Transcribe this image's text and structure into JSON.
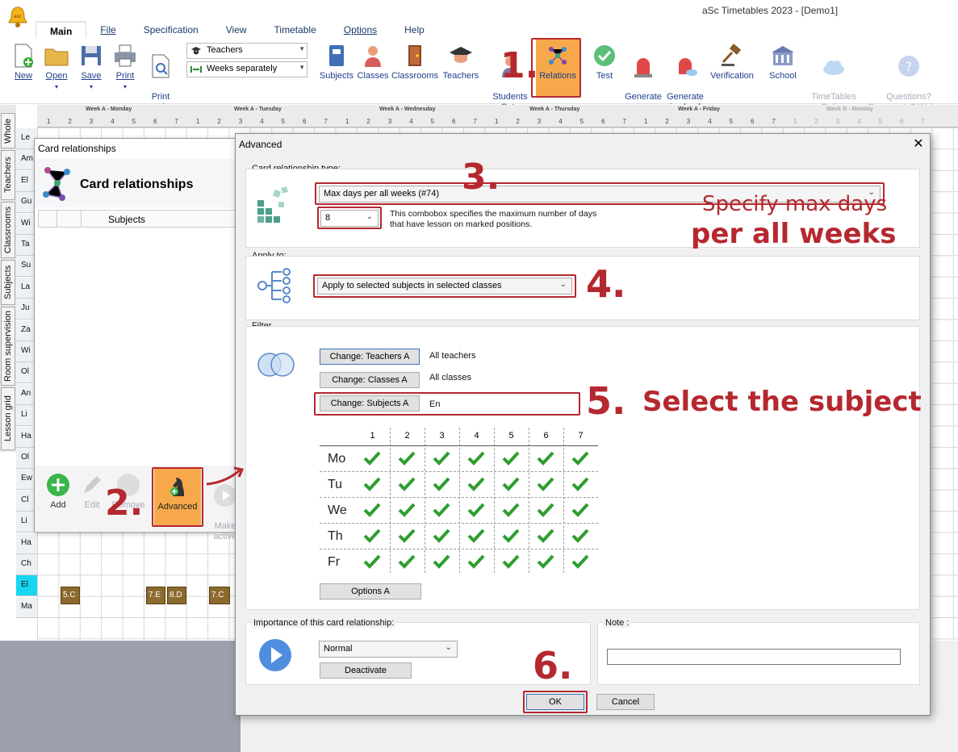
{
  "app": {
    "title": "aSc Timetables 2023  - [Demo1]"
  },
  "menu": [
    "Main",
    "File",
    "Specification",
    "View",
    "Timetable",
    "Options",
    "Help"
  ],
  "ribbon": {
    "new": "New",
    "open": "Open",
    "save": "Save",
    "print": "Print",
    "print_preview": "Print\npreview",
    "combo_teachers": "Teachers",
    "combo_weeks": "Weeks separately",
    "subjects": "Subjects",
    "classes": "Classes",
    "classrooms": "Classrooms",
    "teachers": "Teachers",
    "students": "Students\nSets",
    "relations": "Relations",
    "test": "Test",
    "generate_new": "Generate\nnew",
    "generate_cloud": "Generate\nin cloud",
    "verification": "Verification",
    "school": "School",
    "tt_online": "TimeTables\nOnline",
    "questions": "Questions?\nComments? Write us"
  },
  "side_tabs": [
    "Whole",
    "Teachers",
    "Classrooms",
    "Subjects",
    "Room supervision",
    "Lesson grid"
  ],
  "grid": {
    "weeks": [
      "Week A - Monday",
      "Week A - Tuesday",
      "Week A - Wednesday",
      "Week A - Thursday",
      "Week A - Friday",
      "Week B - Monday"
    ],
    "periods": [
      "1",
      "2",
      "3",
      "4",
      "5",
      "6",
      "7"
    ],
    "rows": [
      "Le",
      "Am",
      "El",
      "Gu",
      "Wi",
      "Ta",
      "Su",
      "La",
      "Ju",
      "Za",
      "Wi",
      "Ol",
      "An",
      "Li",
      "Ha",
      "Ol",
      "Ew",
      "Cl",
      "Li",
      "Ha",
      "Ch",
      "El",
      "Ma"
    ],
    "cards": [
      "5.C",
      "7.E",
      "8.D",
      "7.C"
    ]
  },
  "card_rel": {
    "window_title": "Card relationships",
    "heading": "Card relationships",
    "col_subjects": "Subjects",
    "add": "Add",
    "edit": "Edit",
    "remove": "Remove",
    "advanced": "Advanced",
    "make_active": "Make\nactive"
  },
  "advanced": {
    "title": "Advanced",
    "close": "✕",
    "type_label": "Card relationship type:",
    "type_value": "Max days per all weeks (#74)",
    "count_value": "8",
    "type_desc": "This combobox specifies the maximum number of days\nthat have lesson on marked positions.",
    "apply_label": "Apply to:",
    "apply_value": "Apply to selected subjects in selected classes",
    "filter_label": "Filter",
    "btn_teachers": "Change: Teachers A",
    "val_teachers": "All teachers",
    "btn_classes": "Change: Classes A",
    "val_classes": "All classes",
    "btn_subjects": "Change: Subjects A",
    "val_subjects": "En",
    "periods": [
      "1",
      "2",
      "3",
      "4",
      "5",
      "6",
      "7"
    ],
    "days": [
      "Mo",
      "Tu",
      "We",
      "Th",
      "Fr"
    ],
    "checked": "all",
    "options": "Options A",
    "importance_label": "Importance of this card relationship:",
    "importance_value": "Normal",
    "deactivate": "Deactivate",
    "note_label": "Note :",
    "note_value": "",
    "ok": "OK",
    "cancel": "Cancel"
  },
  "annotations": {
    "step1": "1.",
    "step2": "2.",
    "step3": "3.",
    "step3_note1": "Specify max days",
    "step3_note2": "per all weeks",
    "step4": "4.",
    "step5": "5.",
    "step5_note": "Select the subject",
    "step6": "6."
  },
  "colors": {
    "accent_red": "#b5282f",
    "highlight_orange": "#f6a84a",
    "check_green": "#2e9e2e",
    "menu_blue": "#1f3f8a"
  }
}
